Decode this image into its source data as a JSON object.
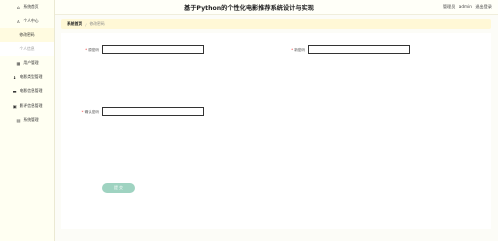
{
  "header": {
    "title": "基于Python的个性化电影推荐系统设计与实现",
    "user_label": "管理员",
    "user_name": "admin",
    "logout": "退出登录"
  },
  "sidebar": {
    "items": [
      {
        "label": "系统首页",
        "icon": "home-icon",
        "glyph": "⌂"
      },
      {
        "label": "个人中心",
        "icon": "person-icon",
        "glyph": "♙"
      },
      {
        "label": "修改密码",
        "icon": "",
        "glyph": ""
      },
      {
        "label": "个人信息",
        "icon": "",
        "glyph": ""
      },
      {
        "label": "用户管理",
        "icon": "grid-icon",
        "glyph": "▦"
      },
      {
        "label": "电影类型管理",
        "icon": "trophy-icon",
        "glyph": "♝"
      },
      {
        "label": "电影信息管理",
        "icon": "film-icon",
        "glyph": "▬"
      },
      {
        "label": "影评信息管理",
        "icon": "comment-icon",
        "glyph": "▣"
      },
      {
        "label": "系统管理",
        "icon": "settings-icon",
        "glyph": "▤"
      }
    ]
  },
  "breadcrumb": {
    "home": "系统首页",
    "current": "修改密码"
  },
  "form": {
    "old_password_label": "原密码",
    "new_password_label": "新密码",
    "confirm_password_label": "确认密码",
    "old_password_value": "",
    "new_password_value": "",
    "confirm_password_value": "",
    "submit_label": "提 交"
  },
  "colors": {
    "submit_button": "#9fd3c1",
    "wave_teal": "#3d8fa0",
    "header_bg": "#fffff8"
  }
}
